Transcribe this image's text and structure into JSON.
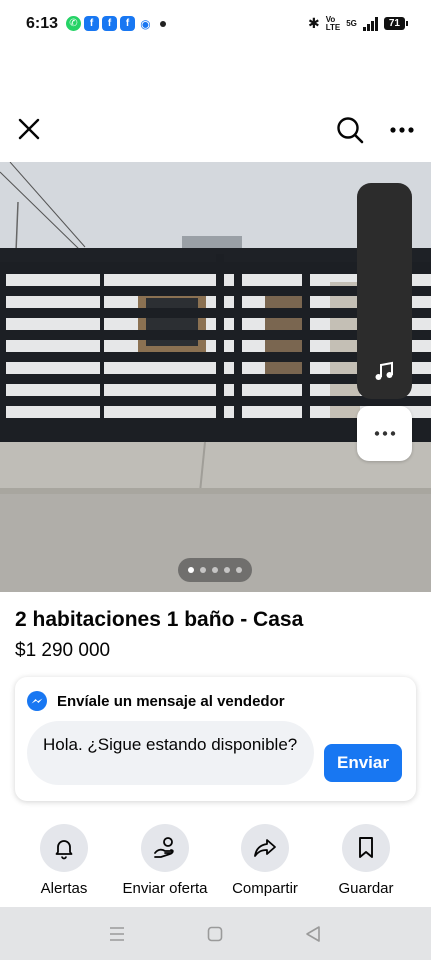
{
  "status_bar": {
    "time": "6:13",
    "network_tag_top": "Vo",
    "network_tag_bottom": "LTE",
    "signal_tag": "5G",
    "battery": "71"
  },
  "listing": {
    "title": "2 habitaciones 1 baño - Casa",
    "price": "$1 290 000",
    "photo_count": 5,
    "photo_index": 1
  },
  "message": {
    "header": "Envíale un mensaje al vendedor",
    "input_value": "Hola. ¿Sigue estando disponible?",
    "send_label": "Enviar"
  },
  "actions": [
    {
      "label": "Alertas",
      "icon": "bell-icon"
    },
    {
      "label": "Enviar oferta",
      "icon": "offer-icon"
    },
    {
      "label": "Compartir",
      "icon": "share-icon"
    },
    {
      "label": "Guardar",
      "icon": "bookmark-icon"
    }
  ],
  "colors": {
    "accent": "#1877f2",
    "circle_bg": "#e4e6eb",
    "input_bg": "#f0f2f5"
  }
}
